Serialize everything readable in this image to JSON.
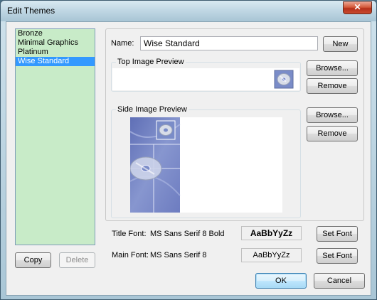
{
  "window": {
    "title": "Edit Themes",
    "close_glyph": "✕"
  },
  "themes": {
    "items": [
      "Bronze",
      "Minimal Graphics",
      "Platinum",
      "Wise Standard"
    ],
    "selected_index": 3
  },
  "left_buttons": {
    "copy": "Copy",
    "delete": "Delete"
  },
  "name": {
    "label": "Name:",
    "value": "Wise Standard",
    "new_button": "New"
  },
  "top_image": {
    "legend": "Top Image Preview",
    "browse": "Browse...",
    "remove": "Remove"
  },
  "side_image": {
    "legend": "Side Image Preview",
    "browse": "Browse...",
    "remove": "Remove"
  },
  "title_font": {
    "label": "Title Font:",
    "value": "MS Sans Serif 8 Bold",
    "sample": "AaBbYyZz",
    "button": "Set Font"
  },
  "main_font": {
    "label": "Main Font:",
    "value": "MS Sans Serif 8",
    "sample": "AaBbYyZz",
    "button": "Set Font"
  },
  "footer": {
    "ok": "OK",
    "cancel": "Cancel"
  },
  "colors": {
    "list_bg": "#c8ebc8",
    "selection": "#3399ff",
    "image_tint": "#7a8cc8"
  },
  "icons": {
    "close": "close-icon",
    "disc": "cd-disc-icon"
  }
}
